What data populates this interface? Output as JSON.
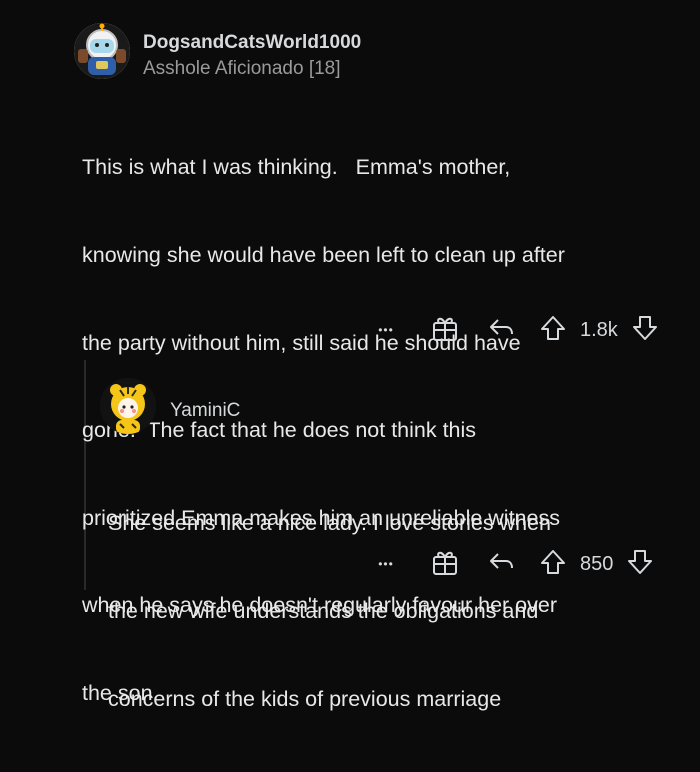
{
  "comment1": {
    "username": "DogsandCatsWorld1000",
    "flair": "Asshole Aficionado [18]",
    "body_lines": [
      "This is what I was thinking.   Emma's mother,",
      "knowing she would have been left to clean up after",
      "the party without him, still said he should have",
      "gone.  The fact that he does not think this",
      "prioritized Emma makes him an unreliable witness",
      "when he says he doesn't regularly favour her over",
      "the son."
    ],
    "vote_count": "1.8k",
    "more_label": "•••"
  },
  "comment2": {
    "username": "YaminiC",
    "body_lines": [
      "She seems like a nice lady. I love stories when",
      "the new wife understands the obligations and",
      "concerns of the kids of previous marriage"
    ],
    "vote_count": "850",
    "more_label": "•••"
  },
  "icons": [
    "award-icon",
    "reply-icon",
    "upvote-icon",
    "downvote-icon"
  ]
}
